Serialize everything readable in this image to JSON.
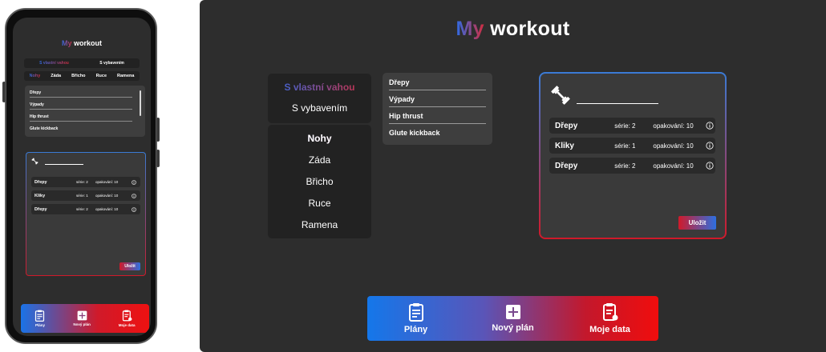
{
  "app": {
    "title_accent": "My",
    "title_rest": "workout",
    "accent_colors": [
      "#2e6be6",
      "#d62c3c"
    ]
  },
  "modes": {
    "bodyweight": "S vlastní vahou",
    "equipment": "S vybavením"
  },
  "categories": [
    "Nohy",
    "Záda",
    "Břicho",
    "Ruce",
    "Ramena"
  ],
  "selected_category": "Nohy",
  "exercises": [
    "Dřepy",
    "Výpady",
    "Hip thrust",
    "Glute kickback"
  ],
  "plan": {
    "icon": "dumbbell-icon",
    "entries": [
      {
        "name": "Dřepy",
        "sets": "série: 2",
        "reps": "opakování: 10"
      },
      {
        "name": "Kliky",
        "sets": "série: 1",
        "reps": "opakování: 10"
      },
      {
        "name": "Dřepy",
        "sets": "série: 2",
        "reps": "opakování: 10"
      }
    ],
    "save_label": "Uložit"
  },
  "nav": {
    "plans": "Plány",
    "new_plan": "Nový plán",
    "my_data": "Moje data"
  }
}
